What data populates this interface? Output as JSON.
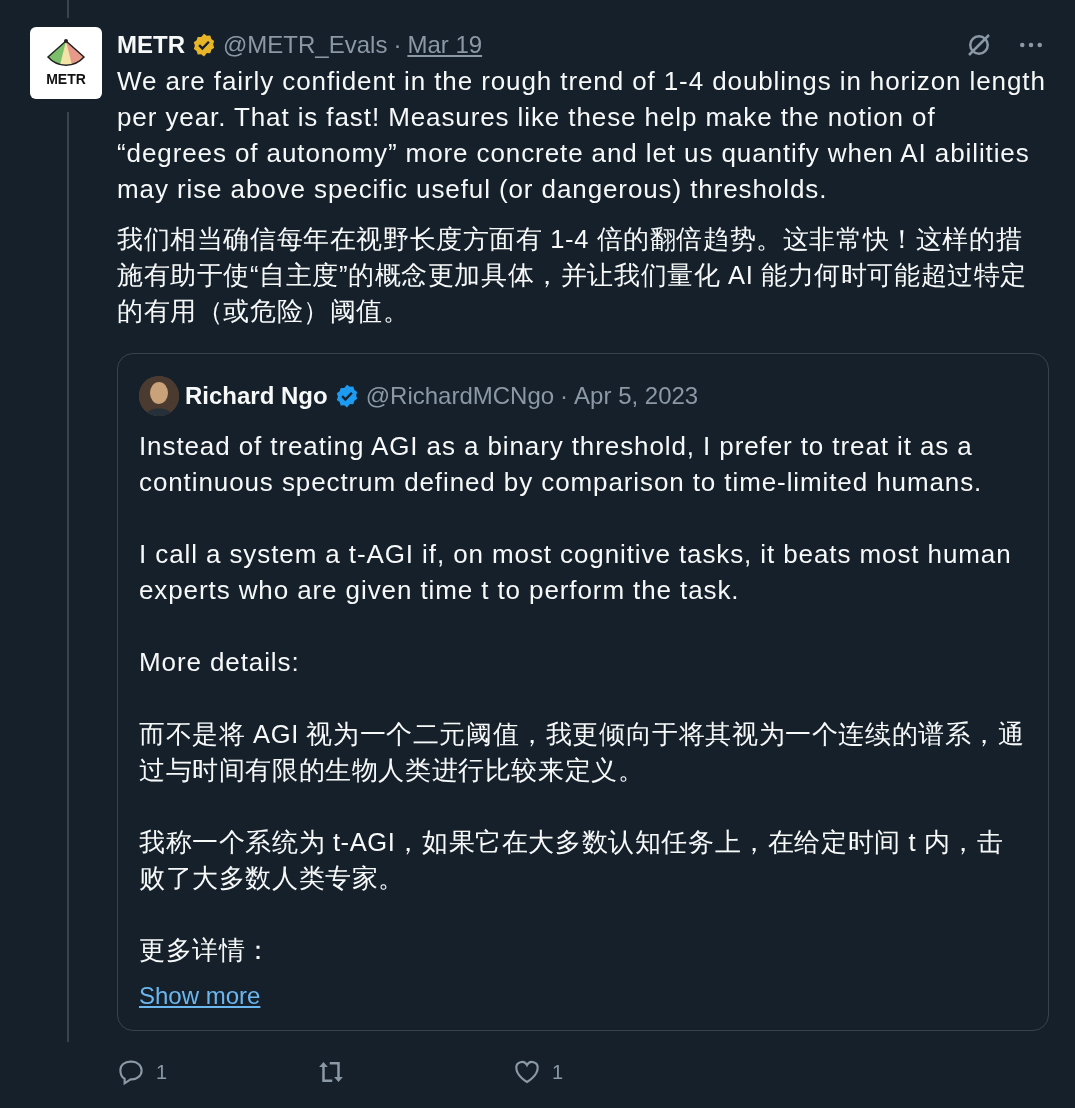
{
  "tweet": {
    "name": "METR",
    "verified": true,
    "handle": "@METR_Evals",
    "separator": "·",
    "date": "Mar 19",
    "paragraphs": [
      "We are fairly confident in the rough trend of 1-4 doublings in horizon length per year. That is fast! Measures like these help make the notion of “degrees of autonomy” more concrete and let us quantify when AI abilities may rise above specific useful (or dangerous) thresholds.",
      "我们相当确信每年在视野长度方面有 1-4 倍的翻倍趋势。这非常快！这样的措施有助于使“自主度”的概念更加具体，并让我们量化 AI 能力何时可能超过特定的有用（或危险）阈值。"
    ],
    "avatar_label": "METR",
    "quote": {
      "name": "Richard Ngo",
      "verified": true,
      "handle": "@RichardMCNgo",
      "separator": "·",
      "date": "Apr 5, 2023",
      "paragraphs": [
        "Instead of treating AGI as a binary threshold, I prefer to treat it as a continuous spectrum defined by comparison to time-limited humans.",
        "I call a system a t-AGI if, on most cognitive tasks, it beats most human experts who are given time t to perform the task.",
        "More details:",
        "而不是将 AGI 视为一个二元阈值，我更倾向于将其视为一个连续的谱系，通过与时间有限的生物人类进行比较来定义。",
        "我称一个系统为 t-AGI，如果它在大多数认知任务上，在给定时间 t 内，击败了大多数人类专家。",
        "更多详情："
      ],
      "show_more": "Show more"
    },
    "actions": [
      {
        "kind": "reply",
        "count": "1"
      },
      {
        "kind": "repost"
      },
      {
        "kind": "like",
        "count": "1"
      }
    ]
  }
}
